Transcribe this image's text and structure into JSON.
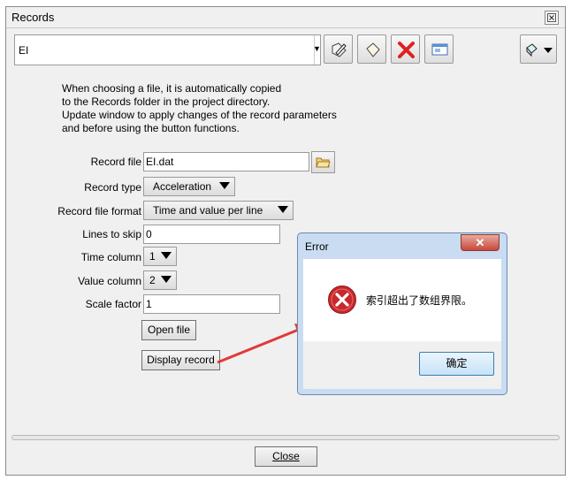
{
  "window": {
    "title": "Records"
  },
  "toolbar": {
    "record_select": "EI",
    "icons": [
      "edit-icon",
      "new-icon",
      "delete-icon",
      "display-icon",
      "menu-icon"
    ]
  },
  "info_text": [
    "When choosing a file, it is automatically copied",
    "to the Records folder in the project directory.",
    "Update window to apply changes of the record parameters",
    "and before using the button functions."
  ],
  "form": {
    "record_file_label": "Record file",
    "record_file_value": "EI.dat",
    "record_type_label": "Record type",
    "record_type_value": "Acceleration",
    "record_file_format_label": "Record file format",
    "record_file_format_value": "Time and value per line",
    "lines_to_skip_label": "Lines to skip",
    "lines_to_skip_value": "0",
    "time_column_label": "Time column",
    "time_column_value": "1",
    "value_column_label": "Value column",
    "value_column_value": "2",
    "scale_factor_label": "Scale factor",
    "scale_factor_value": "1",
    "open_file_label": "Open file",
    "display_record_label": "Display record"
  },
  "footer": {
    "close_label": "Close"
  },
  "error_dialog": {
    "title": "Error",
    "message": "索引超出了数组界限。",
    "ok_label": "确定"
  },
  "colors": {
    "arrow": "#e03a3a",
    "error_icon": "#c8282c"
  }
}
